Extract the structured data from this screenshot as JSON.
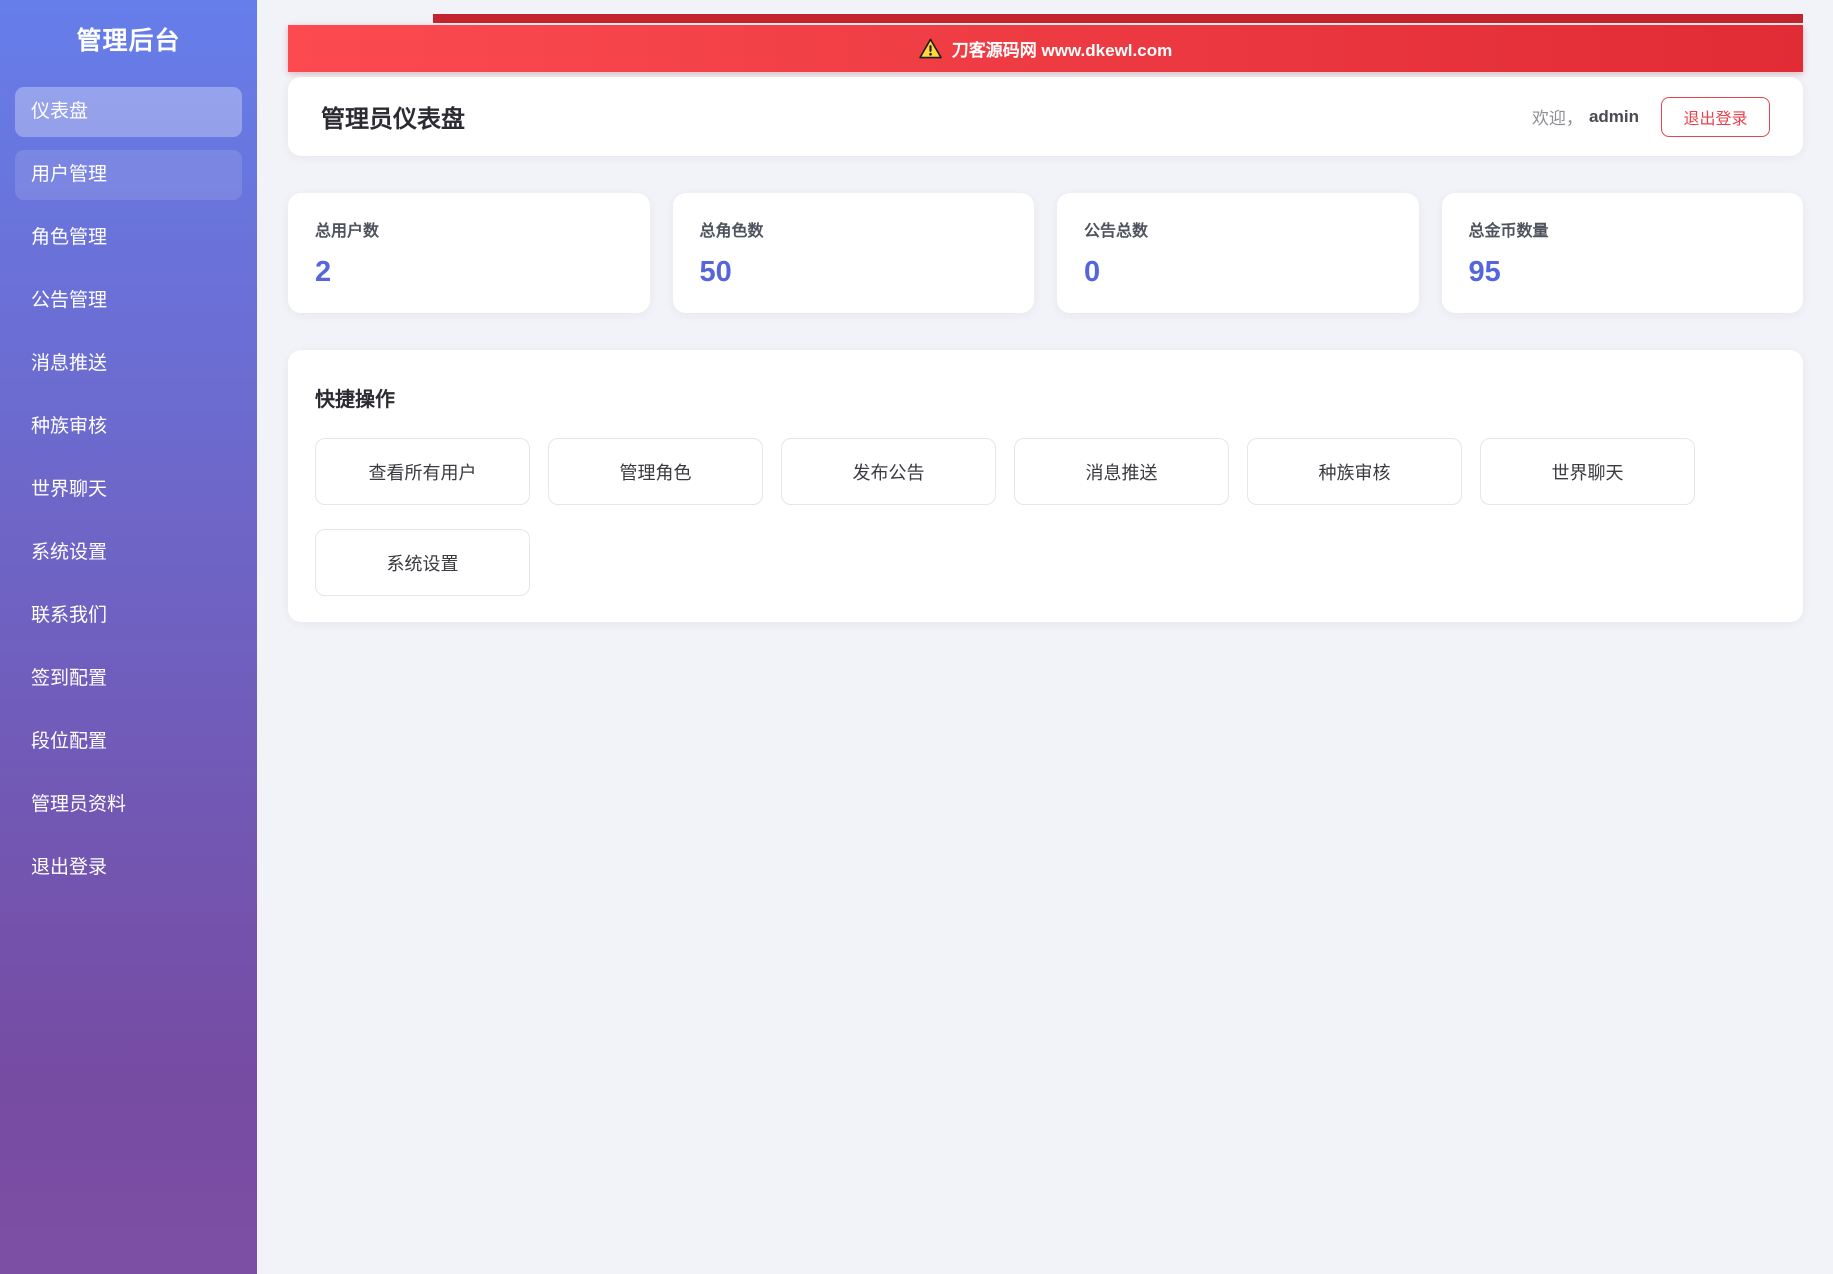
{
  "sidebar": {
    "title": "管理后台",
    "items": [
      "仪表盘",
      "用户管理",
      "角色管理",
      "公告管理",
      "消息推送",
      "种族审核",
      "世界聊天",
      "系统设置",
      "联系我们",
      "签到配置",
      "段位配置",
      "管理员资料",
      "退出登录"
    ],
    "active_item": "仪表盘"
  },
  "banner": {
    "icon": "warning-triangle",
    "text": "刀客源码网 www.dkewl.com"
  },
  "header": {
    "title": "管理员仪表盘",
    "welcome_prefix": "欢迎，",
    "username": "admin",
    "logout_label": "退出登录"
  },
  "stats": [
    {
      "label": "总用户数",
      "value": "2"
    },
    {
      "label": "总角色数",
      "value": "50"
    },
    {
      "label": "公告总数",
      "value": "0"
    },
    {
      "label": "总金币数量",
      "value": "95"
    }
  ],
  "quick_actions": {
    "title": "快捷操作",
    "buttons": [
      "查看所有用户",
      "管理角色",
      "发布公告",
      "消息推送",
      "种族审核",
      "世界聊天",
      "系统设置"
    ]
  },
  "colors": {
    "sidebar_gradient_top": "#667eea",
    "sidebar_gradient_bottom": "#764ba2",
    "banner_red_left": "#fb4b50",
    "banner_red_right": "#e12b35",
    "banner_dark_strip": "#c4242e",
    "stat_value_accent": "#5566dd",
    "logout_red": "#e8434e",
    "page_background": "#f2f3f8"
  }
}
